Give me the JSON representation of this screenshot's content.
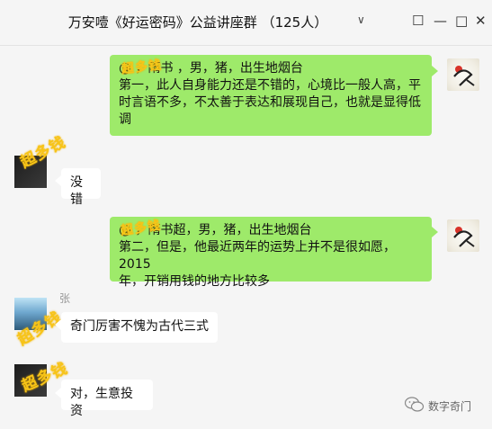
{
  "window": {
    "title": "万安噎《好运密码》公益讲座群 （125人）",
    "dropdown": "∨",
    "buttons": {
      "pin": "☐",
      "minimize": "—",
      "maximize": "□",
      "close": "✕"
    }
  },
  "messages": [
    {
      "side": "right",
      "lines": [
        "@    ，隋书    ，男，猪，出生地烟台",
        "第一，此人自身能力还是不错的，心境比一般人高，平",
        "时言语不多，不太善于表达和展现自己，也就是显得低",
        "调"
      ]
    },
    {
      "side": "left",
      "text": "没错"
    },
    {
      "side": "right",
      "lines": [
        "@    ，隋书超，男，猪，出生地烟台",
        "第二，但是，他最近两年的运势上并不是很如愿，2015",
        "年，开销用钱的地方比较多"
      ]
    },
    {
      "side": "left",
      "sender": "张",
      "text": "奇门厉害不愧为古代三式"
    },
    {
      "side": "left",
      "text": "对，生意投资"
    }
  ],
  "watermark_text": "超多钱",
  "brand": {
    "name": "数字奇门",
    "icon": "wechat-icon"
  },
  "colors": {
    "bubble_right": "#9eea6a",
    "bubble_left": "#ffffff",
    "background": "#f5f5f5",
    "watermark": "#f7c418"
  }
}
